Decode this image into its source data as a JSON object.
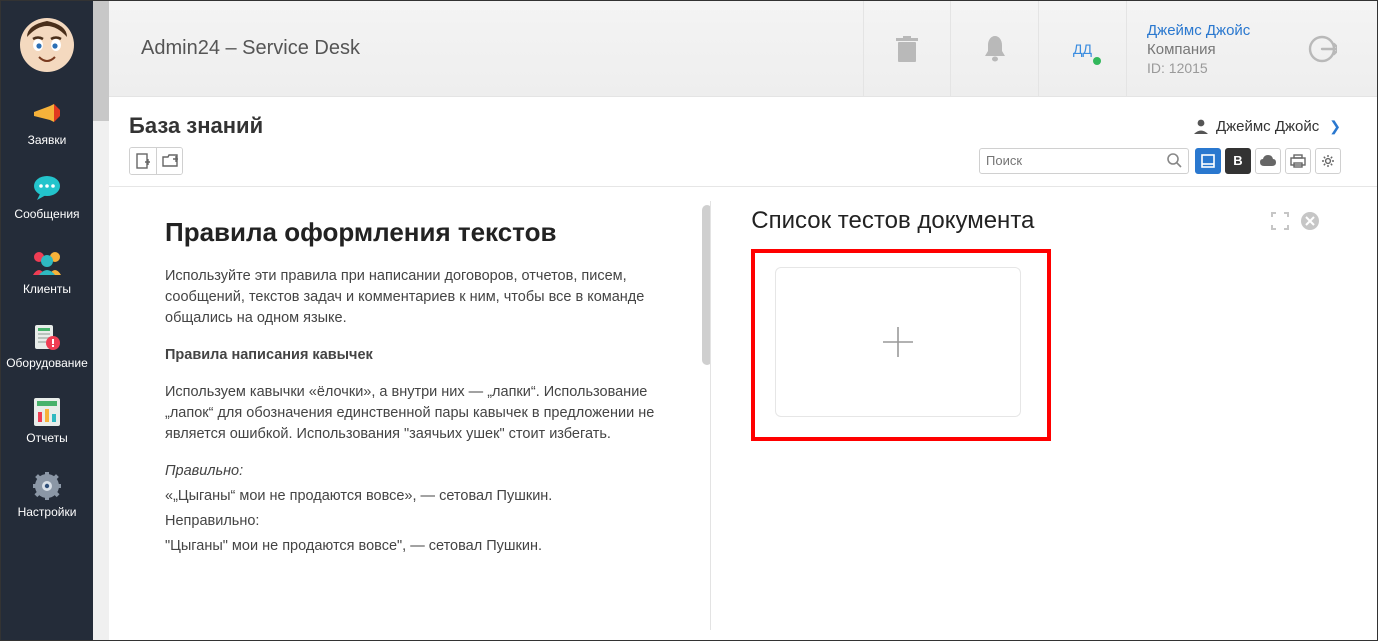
{
  "app": {
    "title": "Admin24 – Service Desk"
  },
  "user": {
    "name": "Джеймс Джойс",
    "company": "Компания",
    "id": "ID: 12015",
    "initials": "ДД"
  },
  "nav": {
    "items": [
      {
        "label": "Заявки"
      },
      {
        "label": "Сообщения"
      },
      {
        "label": "Клиенты"
      },
      {
        "label": "Оборудование"
      },
      {
        "label": "Отчеты"
      },
      {
        "label": "Настройки"
      }
    ]
  },
  "page": {
    "title": "База знаний",
    "owner": "Джеймс Джойс"
  },
  "search": {
    "placeholder": "Поиск"
  },
  "article": {
    "title": "Правила оформления текстов",
    "intro": "Используйте эти правила при написании договоров, отчетов, писем, сообщений, текстов задач и комментариев к ним, чтобы все в команде общались на одном языке.",
    "section_heading": "Правила написания кавычек",
    "para2": "Используем кавычки «ёлочки», а внутри них — „лапки“. Использование „лапок“ для обозначения единственной пары кавычек в предложении не является ошибкой. Использования \"заячьих ушек\" стоит избегать.",
    "correct_label": "Правильно:",
    "correct_example": "«„Цыганы“ мои не продаются вовсе», — сетовал Пушкин.",
    "incorrect_label": "Неправильно:",
    "incorrect_example": "\"Цыганы\" мои не продаются вовсе\", — сетовал Пушкин."
  },
  "right": {
    "title": "Список тестов документа"
  }
}
